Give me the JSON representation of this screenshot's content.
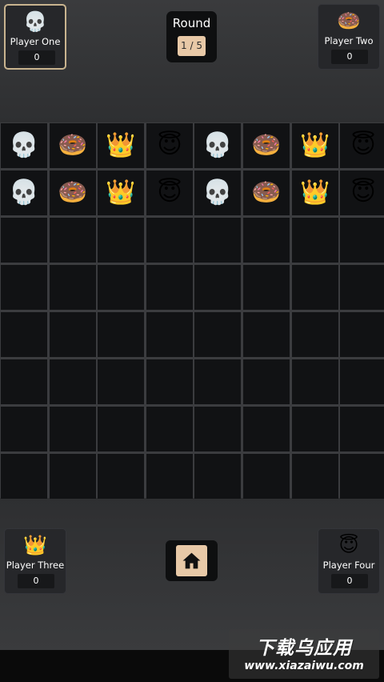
{
  "players": [
    {
      "id": "one",
      "name": "Player One",
      "score": "0",
      "avatar": "💀",
      "avatar_name": "skull",
      "active": true
    },
    {
      "id": "two",
      "name": "Player Two",
      "score": "0",
      "avatar": "🍩",
      "avatar_name": "doughnut",
      "active": false
    },
    {
      "id": "three",
      "name": "Player Three",
      "score": "0",
      "avatar": "👑",
      "avatar_name": "crown",
      "active": false
    },
    {
      "id": "four",
      "name": "Player Four",
      "score": "0",
      "avatar": "😇",
      "avatar_name": "smiling-face-with-halo",
      "active": false
    }
  ],
  "round": {
    "label": "Round",
    "value": "1 / 5"
  },
  "board": {
    "rows": 8,
    "cols": 8,
    "cells": [
      [
        "💀",
        "🍩",
        "👑",
        "😇",
        "💀",
        "🍩",
        "👑",
        "😇"
      ],
      [
        "💀",
        "🍩",
        "👑",
        "😇",
        "💀",
        "🍩",
        "👑",
        "😇"
      ],
      [
        "",
        "",
        "",
        "",
        "",
        "",
        "",
        ""
      ],
      [
        "",
        "",
        "",
        "",
        "",
        "",
        "",
        ""
      ],
      [
        "",
        "",
        "",
        "",
        "",
        "",
        "",
        ""
      ],
      [
        "",
        "",
        "",
        "",
        "",
        "",
        "",
        ""
      ],
      [
        "",
        "",
        "",
        "",
        "",
        "",
        "",
        ""
      ],
      [
        "",
        "",
        "",
        "",
        "",
        "",
        "",
        ""
      ]
    ]
  },
  "home_button": {
    "icon": "home-icon"
  },
  "watermark": {
    "line1": "下载乌应用",
    "line2": "www.xiazaiwu.com"
  },
  "colors": {
    "background": "#2b2c2e",
    "cell": "#111214",
    "grid_line": "#3b3c3f",
    "accent": "#e8c9a7",
    "active_border": "#c9b48f"
  }
}
